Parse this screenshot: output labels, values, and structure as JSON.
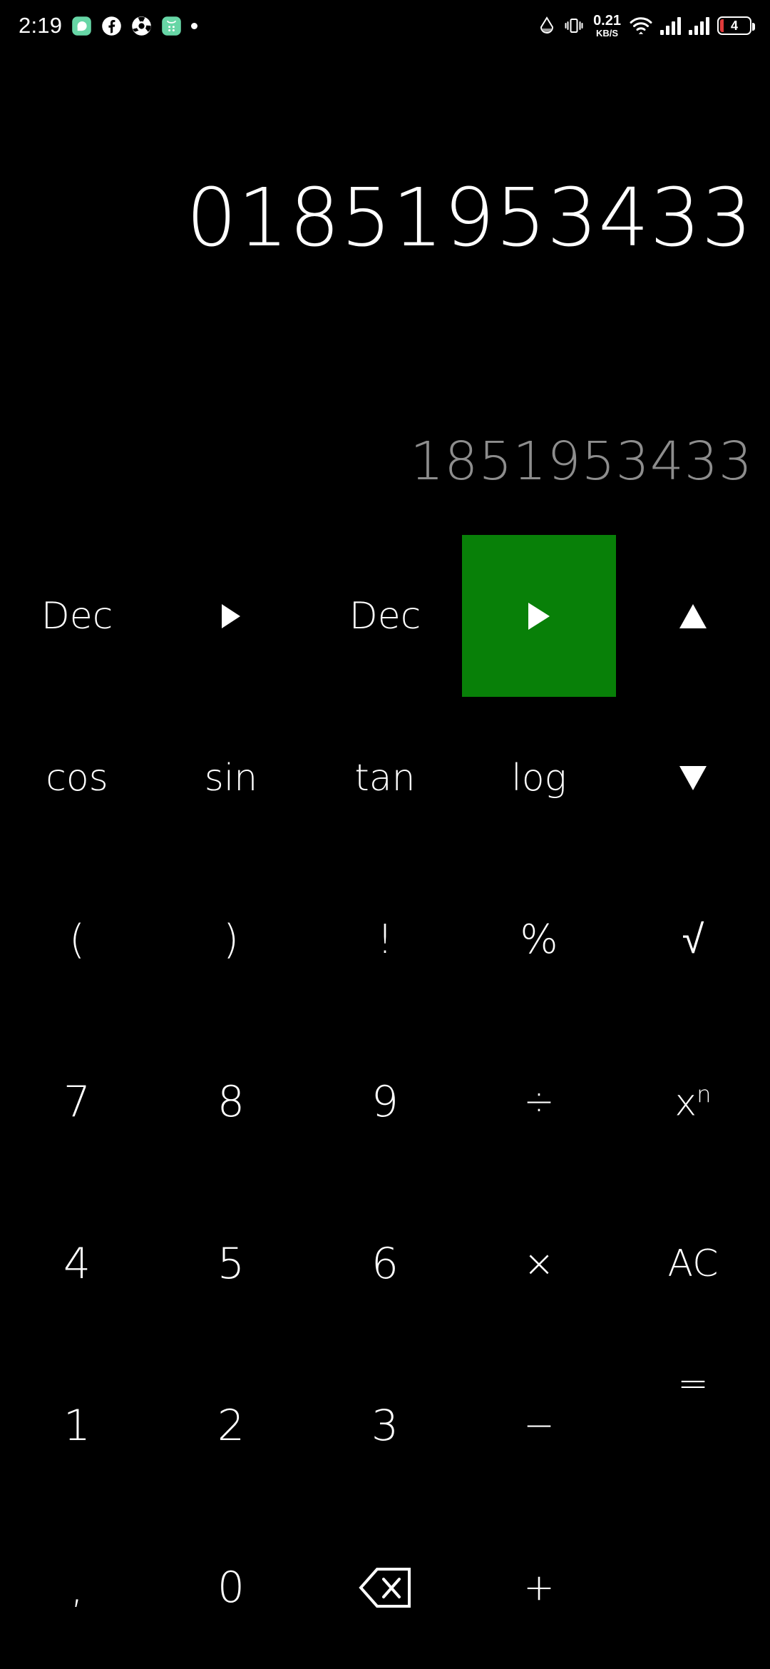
{
  "statusbar": {
    "time": "2:19",
    "left_icons": [
      {
        "name": "messaging-icon",
        "glyph": "message"
      },
      {
        "name": "facebook-icon",
        "glyph": "facebook"
      },
      {
        "name": "app-gear-icon",
        "glyph": "flower"
      },
      {
        "name": "green-app-icon",
        "glyph": "greenapp"
      },
      {
        "name": "more-notifications-dot-icon",
        "glyph": "dot"
      }
    ],
    "right_icons": [
      {
        "name": "water-drop-icon",
        "glyph": "drop"
      },
      {
        "name": "vibrate-mode-icon",
        "glyph": "vibrate"
      }
    ],
    "network_speed_value": "0.21",
    "network_speed_unit": "KB/S",
    "wifi_label": "wifi-icon",
    "signal1_label": "signal-bars-sim1-icon",
    "signal2_label": "signal-bars-sim2-icon",
    "battery_level_text": "4"
  },
  "display": {
    "primary_value": "01851953433",
    "secondary_value": "1851953433"
  },
  "colors": {
    "background": "#000000",
    "primary_text": "#ffffff",
    "secondary_text": "#8d8d8d",
    "accent_green": "#088008"
  },
  "keypad": {
    "rows": [
      [
        {
          "name": "key-dec-left",
          "label": "Dec",
          "kind": "fn",
          "highlight": false
        },
        {
          "name": "key-arrow-right-1",
          "label": "►",
          "kind": "tri-r",
          "highlight": false
        },
        {
          "name": "key-dec-right",
          "label": "Dec",
          "kind": "fn",
          "highlight": false
        },
        {
          "name": "key-arrow-right-2",
          "label": "►",
          "kind": "tri-r",
          "highlight": true
        },
        {
          "name": "key-arrow-up",
          "label": "▲",
          "kind": "tri-u",
          "highlight": false
        }
      ],
      [
        {
          "name": "key-cos",
          "label": "cos",
          "kind": "fn",
          "highlight": false
        },
        {
          "name": "key-sin",
          "label": "sin",
          "kind": "fn",
          "highlight": false
        },
        {
          "name": "key-tan",
          "label": "tan",
          "kind": "fn",
          "highlight": false
        },
        {
          "name": "key-log",
          "label": "log",
          "kind": "fn",
          "highlight": false
        },
        {
          "name": "key-arrow-down",
          "label": "▼",
          "kind": "tri-d",
          "highlight": false
        }
      ],
      [
        {
          "name": "key-paren-open",
          "label": "(",
          "kind": "sym",
          "highlight": false
        },
        {
          "name": "key-paren-close",
          "label": ")",
          "kind": "sym",
          "highlight": false
        },
        {
          "name": "key-factorial",
          "label": "!",
          "kind": "sym",
          "highlight": false
        },
        {
          "name": "key-percent",
          "label": "%",
          "kind": "sym",
          "highlight": false
        },
        {
          "name": "key-sqrt",
          "label": "√",
          "kind": "sym",
          "highlight": false
        }
      ],
      [
        {
          "name": "key-7",
          "label": "7",
          "kind": "num",
          "highlight": false
        },
        {
          "name": "key-8",
          "label": "8",
          "kind": "num",
          "highlight": false
        },
        {
          "name": "key-9",
          "label": "9",
          "kind": "num",
          "highlight": false
        },
        {
          "name": "key-divide",
          "label": "÷",
          "kind": "op",
          "highlight": false
        },
        {
          "name": "key-power",
          "label": "x",
          "sup": "n",
          "kind": "op",
          "highlight": false
        }
      ],
      [
        {
          "name": "key-4",
          "label": "4",
          "kind": "num",
          "highlight": false
        },
        {
          "name": "key-5",
          "label": "5",
          "kind": "num",
          "highlight": false
        },
        {
          "name": "key-6",
          "label": "6",
          "kind": "num",
          "highlight": false
        },
        {
          "name": "key-multiply",
          "label": "×",
          "kind": "op",
          "highlight": false
        },
        {
          "name": "key-all-clear",
          "label": "AC",
          "kind": "op",
          "highlight": false
        }
      ],
      [
        {
          "name": "key-1",
          "label": "1",
          "kind": "num",
          "highlight": false
        },
        {
          "name": "key-2",
          "label": "2",
          "kind": "num",
          "highlight": false
        },
        {
          "name": "key-3",
          "label": "3",
          "kind": "num",
          "highlight": false
        },
        {
          "name": "key-minus",
          "label": "−",
          "kind": "op",
          "highlight": false
        },
        {
          "name": "key-equals",
          "label": "=",
          "kind": "op",
          "highlight": false
        }
      ],
      [
        {
          "name": "key-decimal-comma",
          "label": ",",
          "kind": "num",
          "highlight": false
        },
        {
          "name": "key-0",
          "label": "0",
          "kind": "num",
          "highlight": false
        },
        {
          "name": "key-backspace",
          "label": "⌫",
          "kind": "bksp",
          "highlight": false
        },
        {
          "name": "key-plus",
          "label": "+",
          "kind": "op",
          "highlight": false
        },
        {
          "name": "key-equals-spacer",
          "label": "",
          "kind": "blank",
          "highlight": false
        }
      ]
    ]
  }
}
